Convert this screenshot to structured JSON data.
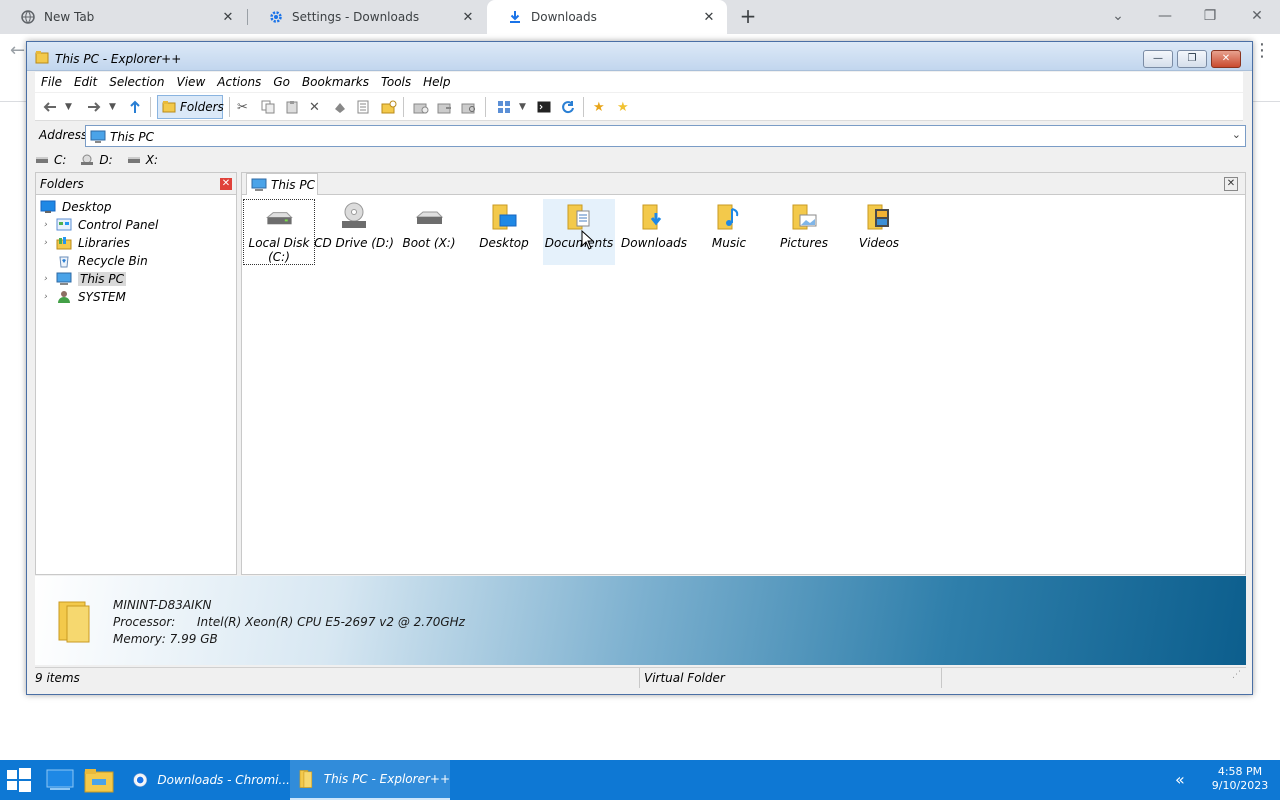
{
  "browser": {
    "tabs": [
      {
        "title": "New Tab",
        "icon": "globe-icon",
        "active": false
      },
      {
        "title": "Settings - Downloads",
        "icon": "gear-icon",
        "active": false
      },
      {
        "title": "Downloads",
        "icon": "download-icon",
        "active": true
      }
    ],
    "new_tab_label": "+",
    "window_controls": {
      "minimize": "—",
      "restore": "❐",
      "close": "✕"
    }
  },
  "explorer": {
    "title": "This PC - Explorer++",
    "window_controls": {
      "minimize": "—",
      "maximize": "❐",
      "close": "✕"
    },
    "menu": [
      "File",
      "Edit",
      "Selection",
      "View",
      "Actions",
      "Go",
      "Bookmarks",
      "Tools",
      "Help"
    ],
    "toolbar": {
      "folders_label": "Folders",
      "buttons": [
        "back-icon",
        "back-dropdown-icon",
        "forward-icon",
        "forward-dropdown-icon",
        "up-icon",
        "cut-icon",
        "copy-icon",
        "paste-icon",
        "delete-icon",
        "delete-permanently-icon",
        "properties-icon",
        "new-folder-icon",
        "copy-to-icon",
        "move-to-icon",
        "search-icon",
        "views-icon",
        "views-dropdown-icon",
        "command-prompt-icon",
        "refresh-icon",
        "bookmark-add-icon",
        "bookmarks-icon"
      ]
    },
    "address": {
      "label": "Address",
      "value": "This PC"
    },
    "drives": [
      {
        "label": "C:"
      },
      {
        "label": "D:"
      },
      {
        "label": "X:"
      }
    ],
    "folders_pane": {
      "title": "Folders",
      "close": "✕",
      "tree": [
        {
          "label": "Desktop",
          "icon": "desktop-icon",
          "expandable": false,
          "level": 0
        },
        {
          "label": "Control Panel",
          "icon": "control-panel-icon",
          "expandable": true,
          "level": 1
        },
        {
          "label": "Libraries",
          "icon": "libraries-icon",
          "expandable": true,
          "level": 1
        },
        {
          "label": "Recycle Bin",
          "icon": "recycle-bin-icon",
          "expandable": false,
          "level": 1
        },
        {
          "label": "This PC",
          "icon": "computer-icon",
          "expandable": true,
          "level": 1,
          "selected": true
        },
        {
          "label": "SYSTEM",
          "icon": "user-icon",
          "expandable": true,
          "level": 1
        }
      ]
    },
    "main_tab": {
      "label": "This PC",
      "close": "✕"
    },
    "items": [
      {
        "label": "Local Disk\n(C:)",
        "icon": "hard-drive-icon",
        "focused": true
      },
      {
        "label": "CD Drive (D:)",
        "icon": "cd-drive-icon"
      },
      {
        "label": "Boot (X:)",
        "icon": "hard-drive-icon"
      },
      {
        "label": "Desktop",
        "icon": "desktop-folder-icon"
      },
      {
        "label": "Documents",
        "icon": "documents-folder-icon",
        "hover": true
      },
      {
        "label": "Downloads",
        "icon": "downloads-folder-icon"
      },
      {
        "label": "Music",
        "icon": "music-folder-icon"
      },
      {
        "label": "Pictures",
        "icon": "pictures-folder-icon"
      },
      {
        "label": "Videos",
        "icon": "videos-folder-icon"
      }
    ],
    "info": {
      "computer_name": "MININT-D83AIKN",
      "processor_label": "Processor:",
      "processor_value": "Intel(R) Xeon(R) CPU E5-2697 v2 @ 2.70GHz",
      "memory": "Memory: 7.99 GB"
    },
    "status": {
      "items_count": "9 items",
      "folder_type": "Virtual Folder"
    }
  },
  "taskbar": {
    "apps": [
      {
        "label": "Downloads - Chromi...",
        "icon": "chrome-icon"
      },
      {
        "label": "This PC - Explorer++",
        "icon": "explorer-plus-icon",
        "active": true
      }
    ],
    "clock_time": "4:58 PM",
    "clock_date": "9/10/2023",
    "tray_chevron": "«"
  },
  "colors": {
    "taskbar": "#0e78d4",
    "folder": "#f3c94b",
    "accent": "#1a73e8"
  }
}
